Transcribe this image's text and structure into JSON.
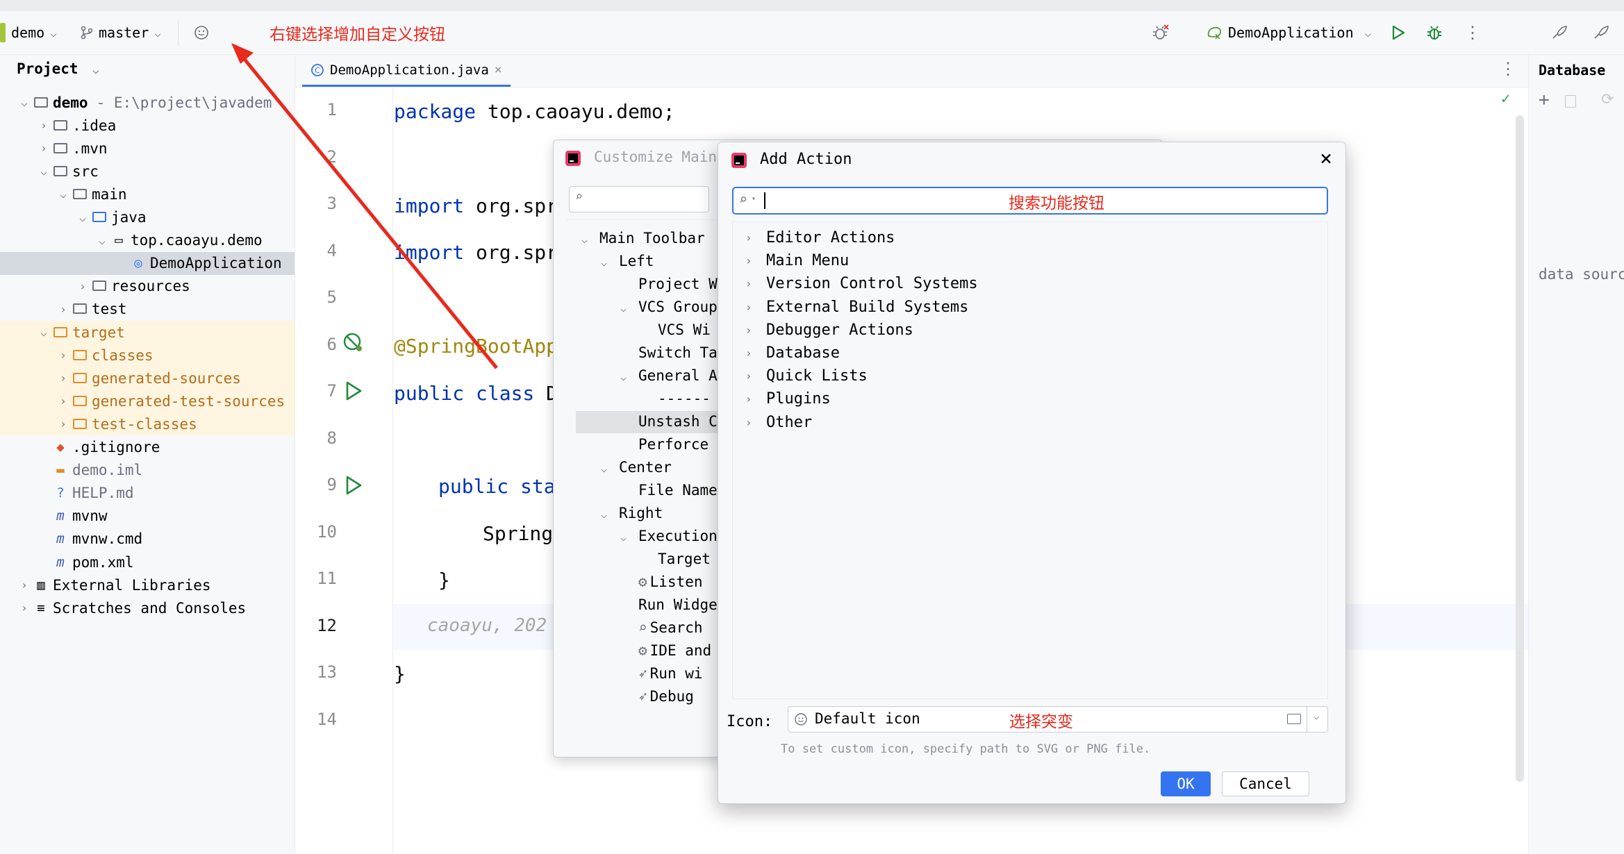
{
  "toolbar": {
    "project": "demo",
    "branch": "master",
    "run_config": "DemoApplication",
    "annotation_customize": "右键选择增加自定义按钮"
  },
  "project_panel": {
    "title": "Project",
    "tree": [
      {
        "label": "demo",
        "suffix": "- E:\\project\\javadem",
        "depth": 0,
        "arrow": "open",
        "icon": "folder-icon",
        "bold": true
      },
      {
        "label": ".idea",
        "depth": 1,
        "arrow": "closed",
        "icon": "idea-folder-icon"
      },
      {
        "label": ".mvn",
        "depth": 1,
        "arrow": "closed",
        "icon": "maven-folder-icon"
      },
      {
        "label": "src",
        "depth": 1,
        "arrow": "open",
        "icon": "folder-icon"
      },
      {
        "label": "main",
        "depth": 2,
        "arrow": "open",
        "icon": "folder-icon"
      },
      {
        "label": "java",
        "depth": 3,
        "arrow": "open",
        "icon": "source-folder-icon"
      },
      {
        "label": "top.caoayu.demo",
        "depth": 4,
        "arrow": "open",
        "icon": "package-icon"
      },
      {
        "label": "DemoApplication",
        "depth": 5,
        "arrow": "none",
        "icon": "spring-class-icon",
        "selected": true
      },
      {
        "label": "resources",
        "depth": 3,
        "arrow": "closed",
        "icon": "resources-folder-icon"
      },
      {
        "label": "test",
        "depth": 2,
        "arrow": "closed",
        "icon": "folder-icon"
      },
      {
        "label": "target",
        "depth": 1,
        "arrow": "open",
        "icon": "excluded-folder-icon",
        "excluded": true
      },
      {
        "label": "classes",
        "depth": 2,
        "arrow": "closed",
        "icon": "excluded-folder-icon",
        "excluded": true
      },
      {
        "label": "generated-sources",
        "depth": 2,
        "arrow": "closed",
        "icon": "excluded-folder-icon",
        "excluded": true
      },
      {
        "label": "generated-test-sources",
        "depth": 2,
        "arrow": "closed",
        "icon": "excluded-folder-icon",
        "excluded": true
      },
      {
        "label": "test-classes",
        "depth": 2,
        "arrow": "closed",
        "icon": "excluded-folder-icon",
        "excluded": true
      },
      {
        "label": ".gitignore",
        "depth": 1,
        "arrow": "none",
        "icon": "git-icon"
      },
      {
        "label": "demo.iml",
        "depth": 1,
        "arrow": "none",
        "icon": "iml-icon",
        "dim": true
      },
      {
        "label": "HELP.md",
        "depth": 1,
        "arrow": "none",
        "icon": "markdown-icon",
        "dim": true
      },
      {
        "label": "mvnw",
        "depth": 1,
        "arrow": "none",
        "icon": "maven-icon"
      },
      {
        "label": "mvnw.cmd",
        "depth": 1,
        "arrow": "none",
        "icon": "maven-icon"
      },
      {
        "label": "pom.xml",
        "depth": 1,
        "arrow": "none",
        "icon": "maven-icon"
      },
      {
        "label": "External Libraries",
        "depth": 0,
        "arrow": "closed",
        "icon": "library-icon"
      },
      {
        "label": "Scratches and Consoles",
        "depth": 0,
        "arrow": "closed",
        "icon": "scratches-icon"
      }
    ]
  },
  "editor": {
    "tab": "DemoApplication.java",
    "line_numbers": [
      "1",
      "2",
      "3",
      "4",
      "5",
      "6",
      "7",
      "8",
      "9",
      "10",
      "11",
      "12",
      "13",
      "14"
    ],
    "lines": {
      "l1_kw": "package",
      "l1_rest": " top.caoayu.demo;",
      "l3_kw": "import",
      "l3_rest": " org.spr",
      "l4_kw": "import",
      "l4_rest": " org.spr",
      "l6": "@SpringBootAppl",
      "l7_kw": "public class",
      "l7_rest": " De",
      "l9_kw": "public stat",
      "l10": "Spring",
      "l11": "}",
      "l12_blame": "caoayu, 202",
      "l13": "}"
    }
  },
  "database_panel": {
    "title": "Database",
    "hint": "data sourc"
  },
  "customize_dialog": {
    "title": "Customize Main",
    "rows": [
      {
        "label": "Main Toolbar",
        "arrow": "open",
        "indent": 0
      },
      {
        "label": "Left",
        "arrow": "open",
        "indent": 1
      },
      {
        "label": "Project W",
        "arrow": "none",
        "indent": 2
      },
      {
        "label": "VCS Group",
        "arrow": "open",
        "indent": 2
      },
      {
        "label": "VCS Wi",
        "arrow": "none",
        "indent": 3
      },
      {
        "label": "Switch Ta",
        "arrow": "none",
        "indent": 2
      },
      {
        "label": "General A",
        "arrow": "open",
        "indent": 2
      },
      {
        "label": "------",
        "arrow": "none",
        "indent": 3
      },
      {
        "label": "Unstash C",
        "arrow": "none",
        "indent": 2,
        "selected": true
      },
      {
        "label": "Perforce",
        "arrow": "none",
        "indent": 2
      },
      {
        "label": "Center",
        "arrow": "open",
        "indent": 1
      },
      {
        "label": "File Name",
        "arrow": "none",
        "indent": 2
      },
      {
        "label": "Right",
        "arrow": "open",
        "indent": 1
      },
      {
        "label": "Execution",
        "arrow": "open",
        "indent": 2
      },
      {
        "label": "Target",
        "arrow": "none",
        "indent": 3
      },
      {
        "label": "Listen",
        "arrow": "none",
        "indent": 2,
        "icon": "bug-icon"
      },
      {
        "label": "Run Widge",
        "arrow": "none",
        "indent": 2
      },
      {
        "label": "Search",
        "arrow": "none",
        "indent": 2,
        "icon": "search-icon"
      },
      {
        "label": "IDE and",
        "arrow": "none",
        "indent": 2,
        "icon": "gear-icon"
      },
      {
        "label": "Run wi",
        "arrow": "none",
        "indent": 2,
        "icon": "rocket-icon"
      },
      {
        "label": "Debug",
        "arrow": "none",
        "indent": 2,
        "icon": "rocket-icon"
      }
    ]
  },
  "add_action_dialog": {
    "title": "Add Action",
    "search_value": "",
    "annotation_search": "搜索功能按钮",
    "items": [
      "Editor Actions",
      "Main Menu",
      "Version Control Systems",
      "External Build Systems",
      "Debugger Actions",
      "Database",
      "Quick Lists",
      "Plugins",
      "Other"
    ],
    "icon_label": "Icon:",
    "icon_value": "Default icon",
    "annotation_icon": "选择突变",
    "hint": "To set custom icon, specify path to SVG or PNG file.",
    "ok": "OK",
    "cancel": "Cancel"
  },
  "colors": {
    "accent": "#3574f0",
    "annotation": "#e8291c",
    "run_green": "#208a3c"
  }
}
